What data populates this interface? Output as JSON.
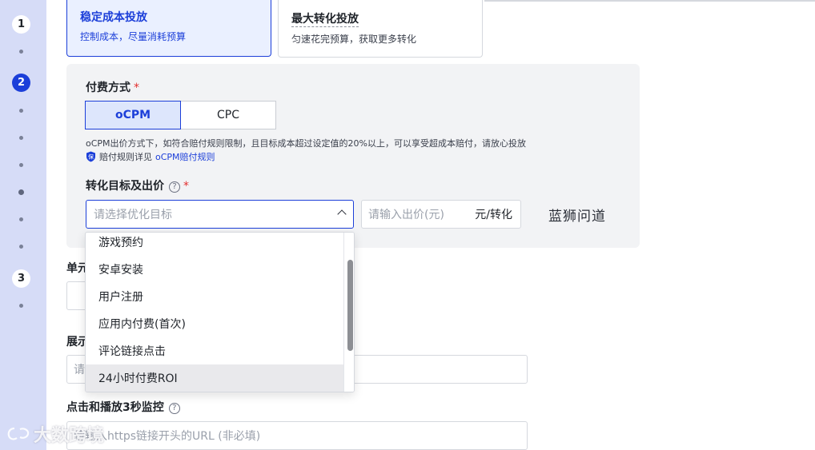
{
  "rail": {
    "steps": [
      "1",
      "2",
      "3"
    ]
  },
  "strategy": {
    "selected": {
      "title": "稳定成本投放",
      "subtitle": "控制成本，尽量消耗预算"
    },
    "other": {
      "title": "最大转化投放",
      "subtitle": "匀速花完预算，获取更多转化"
    }
  },
  "payment": {
    "label": "付费方式",
    "required_mark": "*",
    "options": [
      "oCPM",
      "CPC"
    ],
    "note": "oCPM出价方式下，如符合赔付规则限制，且目标成本超过设定值的20%以上，可以享受超成本赔付，请放心投放",
    "rule_prefix": "赔付规则详见",
    "rule_link": "oCPM赔付规则"
  },
  "target": {
    "label": "转化目标及出价",
    "help": "?",
    "required_mark": "*",
    "select_placeholder": "请选择优化目标",
    "bid_placeholder": "请输入出价(元)",
    "bid_unit": "元/转化",
    "watermark": "蓝狮问道"
  },
  "dropdown": {
    "options": [
      "游戏预约",
      "安卓安装",
      "用户注册",
      "应用内付费(首次)",
      "评论链接点击",
      "24小时付费ROI"
    ],
    "hovered_index": 5
  },
  "lower_form": {
    "unit_label_partial": "单元",
    "display_label_partial": "展示",
    "display_placeholder_partial": "请",
    "monitor_label": "点击和播放3秒监控",
    "monitor_help": "?",
    "monitor_placeholder": "请输入https链接开头的URL (非必填)"
  },
  "overlay_watermark": "大数跨境"
}
